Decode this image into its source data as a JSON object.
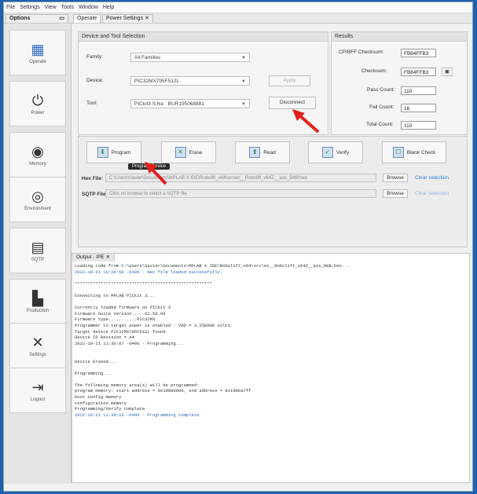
{
  "menu": [
    "File",
    "Settings",
    "View",
    "Tools",
    "Window",
    "Help"
  ],
  "top_tabs": {
    "options": "Options",
    "operate": "Operate",
    "power_settings": "Power Settings"
  },
  "sidebar": {
    "items": [
      {
        "label": "Operate",
        "icon": "grid-icon"
      },
      {
        "label": "Power",
        "icon": "power-icon"
      },
      {
        "label": "Memory",
        "icon": "memory-icon"
      },
      {
        "label": "Environment",
        "icon": "environment-icon"
      },
      {
        "label": "SQTP",
        "icon": "sqtp-icon"
      },
      {
        "label": "Production",
        "icon": "production-icon"
      },
      {
        "label": "Settings",
        "icon": "settings-icon"
      },
      {
        "label": "Logout",
        "icon": "logout-icon"
      }
    ]
  },
  "device_group": {
    "title": "Device and Tool Selection",
    "family_label": "Family:",
    "family_value": "All Families",
    "device_label": "Device:",
    "device_value": "PIC32MX795F512L",
    "tool_label": "Tool:",
    "tool_value": "PICkit3 S.No : BUR195068881",
    "apply": "Apply",
    "disconnect": "Disconnect"
  },
  "results": {
    "title": "Results",
    "cpbff_label": "CP/BFF Checksum:",
    "cpbff_value": "FB84FFB3",
    "checksum_label": "Checksum:",
    "checksum_value": "FB84FFB3",
    "pass_label": "Pass Count:",
    "pass_value": "110",
    "fail_label": "Fail Count:",
    "fail_value": "16",
    "total_label": "Total Count:",
    "total_value": "110"
  },
  "actions": {
    "program": "Program",
    "erase": "Erase",
    "read": "Read",
    "verify": "Verify",
    "blank_check": "Blank Check"
  },
  "tooltip": "Program Device",
  "hex_file": {
    "label": "Hex File:",
    "path": "C:\\Users\\Savier\\Documents\\MPLAB X IDE\\Robolift_v64\\src\\ex__Robolift_v64Z__ass_D8B\\hex",
    "browse": "Browse",
    "clear": "Clear selection"
  },
  "sqtp_file": {
    "label": "SQTP File:",
    "path": "Click on browse to select a SQTP file",
    "browse": "Browse",
    "clear": "Clear selection"
  },
  "output": {
    "tab": "Output - IPE",
    "lines": [
      {
        "t": "Loading code from C:\\Users\\Savier\\Documents\\MPLAB X IDE\\Robolift_v64\\src\\ex__Robolift_v64Z__ass_D8B.hex...",
        "c": "n"
      },
      {
        "t": "2022-10-21 10:24:59 -0400 - Hex file loaded successfully.",
        "c": "b"
      },
      {
        "t": "",
        "c": "n"
      },
      {
        "t": "*****************************************************",
        "c": "n"
      },
      {
        "t": "",
        "c": "n"
      },
      {
        "t": "Connecting to MPLAB PICkit 3...",
        "c": "n"
      },
      {
        "t": "",
        "c": "n"
      },
      {
        "t": "Currently loaded firmware on PICkit 3",
        "c": "n"
      },
      {
        "t": "Firmware Suite Version.....01.56.09",
        "c": "n"
      },
      {
        "t": "Firmware type...........PIC32MX",
        "c": "n"
      },
      {
        "t": "Programmer to target power is enabled - VDD = 3.250000 volts.",
        "c": "n"
      },
      {
        "t": "Target device PIC32MX795F512L found.",
        "c": "n"
      },
      {
        "t": "Device ID Revision = A4",
        "c": "n"
      },
      {
        "t": "2022-10-21 11:30:07 -0400 - Programming...",
        "c": "n"
      },
      {
        "t": "",
        "c": "n"
      },
      {
        "t": "",
        "c": "n"
      },
      {
        "t": "Device Erased...",
        "c": "n"
      },
      {
        "t": "",
        "c": "n"
      },
      {
        "t": "Programming...",
        "c": "n"
      },
      {
        "t": "",
        "c": "n"
      },
      {
        "t": "The following memory area(s) will be programmed:",
        "c": "n"
      },
      {
        "t": "program memory: start address = 0x1d000000, end address = 0x1d00a7ff",
        "c": "n"
      },
      {
        "t": "boot config memory",
        "c": "n"
      },
      {
        "t": "configuration memory",
        "c": "n"
      },
      {
        "t": "Programming/Verify complete",
        "c": "n"
      },
      {
        "t": "2022-10-21 11:30:16 -0400 - Programming complete",
        "c": "b"
      }
    ]
  },
  "colors": {
    "accent": "#2f6fbf",
    "annotation_arrow": "#e4201c",
    "link": "#2a7fd8"
  }
}
